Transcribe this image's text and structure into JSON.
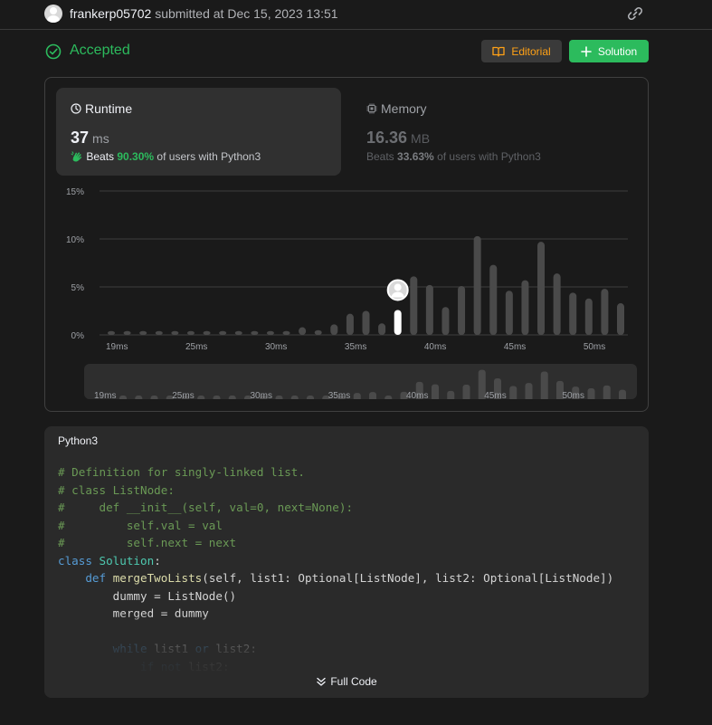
{
  "header": {
    "username": "frankerp05702",
    "submitted_text": "submitted at Dec 15, 2023 13:51"
  },
  "status": {
    "label": "Accepted",
    "editorial_label": "Editorial",
    "solution_label": "Solution",
    "accent_color": "#2cbb5d",
    "editorial_color": "#ffa116"
  },
  "runtime": {
    "title": "Runtime",
    "value": "37",
    "unit": "ms",
    "beats_prefix": "Beats",
    "beats_pct": "90.30%",
    "beats_suffix": "of users with Python3"
  },
  "memory": {
    "title": "Memory",
    "value": "16.36",
    "unit": "MB",
    "beats_prefix": "Beats",
    "beats_pct": "33.63%",
    "beats_suffix": "of users with Python3"
  },
  "chart_data": {
    "type": "bar",
    "xlabel": "",
    "ylabel": "",
    "ylim": [
      0,
      15
    ],
    "y_ticks": [
      "15%",
      "10%",
      "5%",
      "0%"
    ],
    "x_tick_labels": [
      "19ms",
      "25ms",
      "30ms",
      "35ms",
      "40ms",
      "45ms",
      "50ms"
    ],
    "x_tick_values": [
      19,
      24,
      29,
      34,
      39,
      44,
      49
    ],
    "x": [
      19,
      20,
      21,
      22,
      23,
      24,
      25,
      26,
      27,
      28,
      29,
      30,
      31,
      32,
      33,
      34,
      35,
      36,
      37,
      38,
      39,
      40,
      41,
      42,
      43,
      44,
      45,
      46,
      47,
      48,
      49,
      50,
      51
    ],
    "values": [
      0.4,
      0.4,
      0.4,
      0.4,
      0.4,
      0.4,
      0.4,
      0.4,
      0.4,
      0.4,
      0.4,
      0.4,
      0.8,
      0.5,
      1.1,
      2.2,
      2.5,
      1.2,
      2.6,
      6.1,
      5.2,
      2.9,
      5.1,
      10.3,
      7.3,
      4.6,
      5.7,
      9.7,
      6.4,
      4.4,
      3.8,
      4.8,
      3.3
    ],
    "highlight_x": 37,
    "grid": true,
    "bar_color": "#4a4a4a",
    "highlight_color": "#ffffff"
  },
  "code": {
    "language": "Python3",
    "lines": [
      [
        {
          "t": "# Definition for singly-linked list.",
          "c": "cm"
        }
      ],
      [
        {
          "t": "# class ListNode:",
          "c": "cm"
        }
      ],
      [
        {
          "t": "#     def __init__(self, val=0, next=None):",
          "c": "cm"
        }
      ],
      [
        {
          "t": "#         self.val = val",
          "c": "cm"
        }
      ],
      [
        {
          "t": "#         self.next = next",
          "c": "cm"
        }
      ],
      [
        {
          "t": "class",
          "c": "kw"
        },
        {
          "t": " "
        },
        {
          "t": "Solution",
          "c": "cls"
        },
        {
          "t": ":"
        }
      ],
      [
        {
          "t": "    "
        },
        {
          "t": "def",
          "c": "kw"
        },
        {
          "t": " "
        },
        {
          "t": "mergeTwoLists",
          "c": "fn"
        },
        {
          "t": "(self, list1: Optional[ListNode], list2: Optional[ListNode])"
        }
      ],
      [
        {
          "t": "        dummy = ListNode()"
        }
      ],
      [
        {
          "t": "        merged = dummy"
        }
      ],
      [
        {
          "t": ""
        }
      ],
      [
        {
          "t": "        "
        },
        {
          "t": "while",
          "c": "kw"
        },
        {
          "t": " list1 "
        },
        {
          "t": "or",
          "c": "kw"
        },
        {
          "t": " list2:"
        }
      ],
      [
        {
          "t": "            "
        },
        {
          "t": "if",
          "c": "kw"
        },
        {
          "t": " "
        },
        {
          "t": "not",
          "c": "kw"
        },
        {
          "t": " list2:"
        }
      ]
    ],
    "full_code_label": "Full Code"
  }
}
